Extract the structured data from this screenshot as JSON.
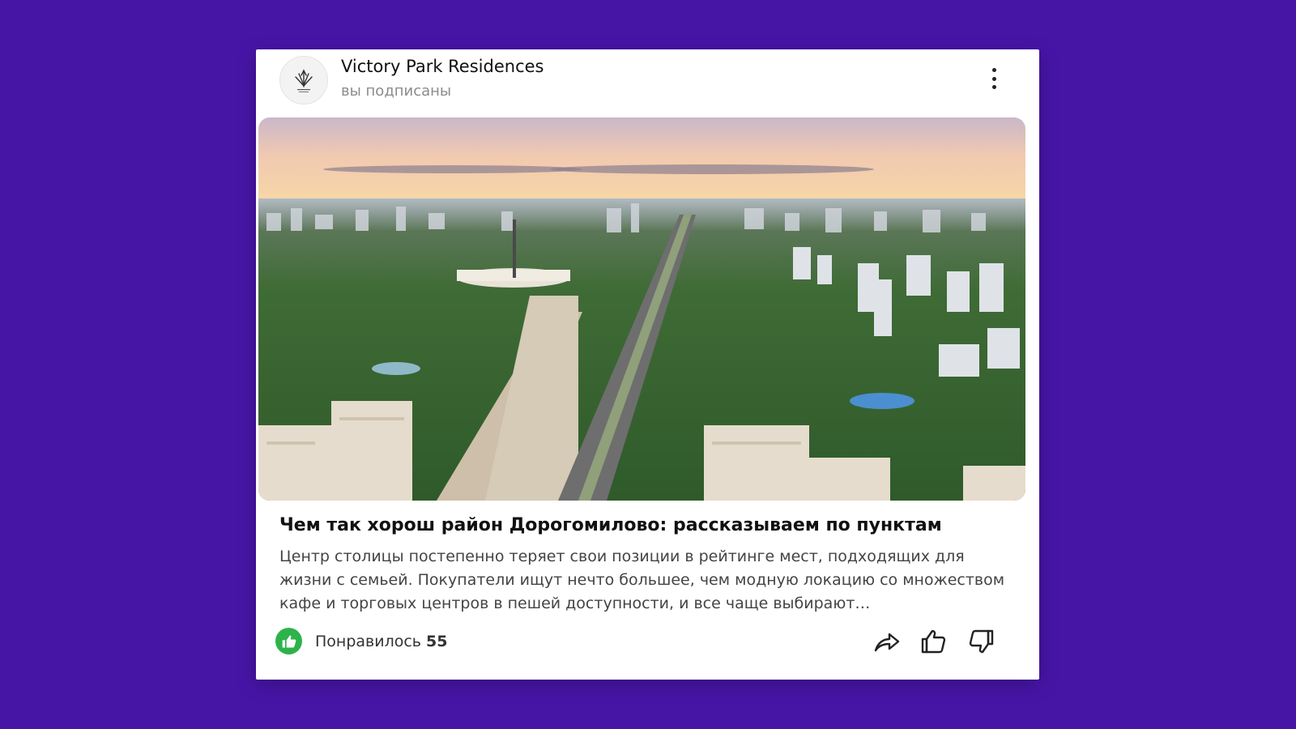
{
  "colors": {
    "background": "#4715a6",
    "card": "#ffffff",
    "like_badge": "#2db34a",
    "text_primary": "#111111",
    "text_secondary": "#8c8c8c"
  },
  "channel": {
    "name": "Victory Park Residences",
    "status": "вы подписаны",
    "logo_icon": "victory-park-logo-icon"
  },
  "article": {
    "image_subject": "aerial-city-park-photo",
    "title": "Чем так хорош район Дорогомилово: рассказываем по пунктам",
    "snippet": "Центр столицы постепенно теряет свои позиции в рейтинге мест, подходящих для жизни с семьей. Покупатели ищут нечто большее, чем модную локацию со множеством кафе и торговых центров в пешей доступности, и все чаще выбирают…"
  },
  "footer": {
    "likes_label": "Понравилось",
    "likes_count": "55",
    "icons": [
      "thumbs-up-icon",
      "share-icon",
      "like-icon",
      "dislike-icon"
    ]
  },
  "menu": {
    "icon": "more-vertical-icon"
  }
}
